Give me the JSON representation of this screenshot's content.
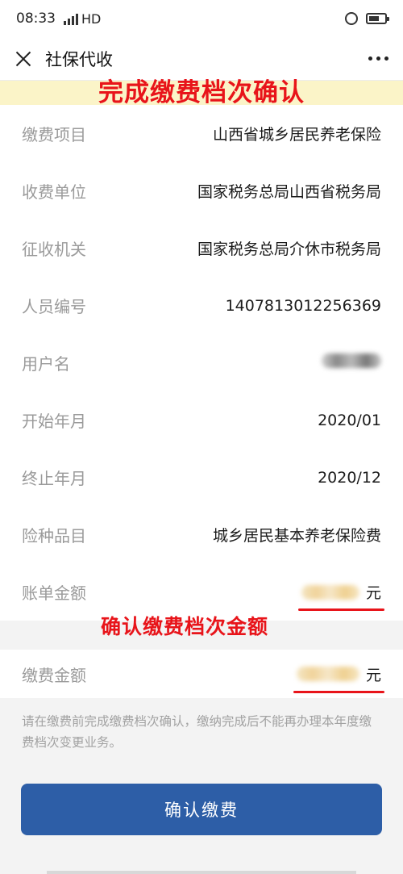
{
  "status_bar": {
    "time": "08:33",
    "network": "HD",
    "signal_icon": "signal-4g-icon",
    "alarm_icon": "alarm-icon",
    "battery_icon": "battery-icon"
  },
  "nav": {
    "title": "社保代收",
    "close_icon": "close-icon",
    "more_icon": "more-dots-icon"
  },
  "annotations": {
    "top_banner": "完成缴费档次确认",
    "amount_note": "确认缴费档次金额",
    "annotation_color": "#e8141a"
  },
  "details": {
    "rows": [
      {
        "label": "缴费项目",
        "value": "山西省城乡居民养老保险"
      },
      {
        "label": "收费单位",
        "value": "国家税务总局山西省税务局"
      },
      {
        "label": "征收机关",
        "value": "国家税务总局介休市税务局"
      },
      {
        "label": "人员编号",
        "value": "1407813012256369"
      },
      {
        "label": "用户名",
        "value": ""
      },
      {
        "label": "开始年月",
        "value": "2020/01"
      },
      {
        "label": "终止年月",
        "value": "2020/12"
      },
      {
        "label": "险种品目",
        "value": "城乡居民基本养老保险费"
      }
    ],
    "bill_amount": {
      "label": "账单金额",
      "unit": "元"
    }
  },
  "payment": {
    "label": "缴费金额",
    "unit": "元"
  },
  "notice": "请在缴费前完成缴费档次确认，缴纳完成后不能再办理本年度缴费档次变更业务。",
  "confirm_button": {
    "label": "确认缴费",
    "color": "#2d5ea7"
  }
}
